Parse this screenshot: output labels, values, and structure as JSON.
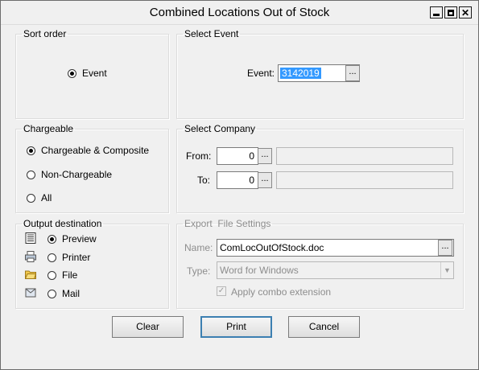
{
  "window": {
    "title": "Combined Locations Out of Stock"
  },
  "sort_order": {
    "legend": "Sort order",
    "options": [
      {
        "label": "Event",
        "selected": true
      }
    ]
  },
  "select_event": {
    "legend": "Select Event",
    "event_label": "Event:",
    "event_value": "3142019",
    "browse_label": "..."
  },
  "chargeable": {
    "legend": "Chargeable",
    "options": [
      {
        "label": "Chargeable & Composite",
        "selected": true
      },
      {
        "label": "Non-Chargeable",
        "selected": false
      },
      {
        "label": "All",
        "selected": false
      }
    ]
  },
  "select_company": {
    "legend": "Select Company",
    "from_label": "From:",
    "from_value": "0",
    "from_browse": "...",
    "from_name": "",
    "to_label": "To:",
    "to_value": "0",
    "to_browse": "...",
    "to_name": ""
  },
  "output_destination": {
    "legend": "Output destination",
    "options": [
      {
        "label": "Preview",
        "selected": true,
        "icon": "preview-icon"
      },
      {
        "label": "Printer",
        "selected": false,
        "icon": "printer-icon"
      },
      {
        "label": "File",
        "selected": false,
        "icon": "folder-icon"
      },
      {
        "label": "Mail",
        "selected": false,
        "icon": "mail-icon"
      }
    ]
  },
  "export_settings": {
    "legend": "Export  File Settings",
    "name_label": "Name:",
    "name_value": "ComLocOutOfStock.doc",
    "name_browse": "...",
    "type_label": "Type:",
    "type_value": "Word for Windows",
    "apply_label": "Apply combo extension",
    "apply_checked": true
  },
  "buttons": {
    "clear": "Clear",
    "print": "Print",
    "cancel": "Cancel"
  }
}
